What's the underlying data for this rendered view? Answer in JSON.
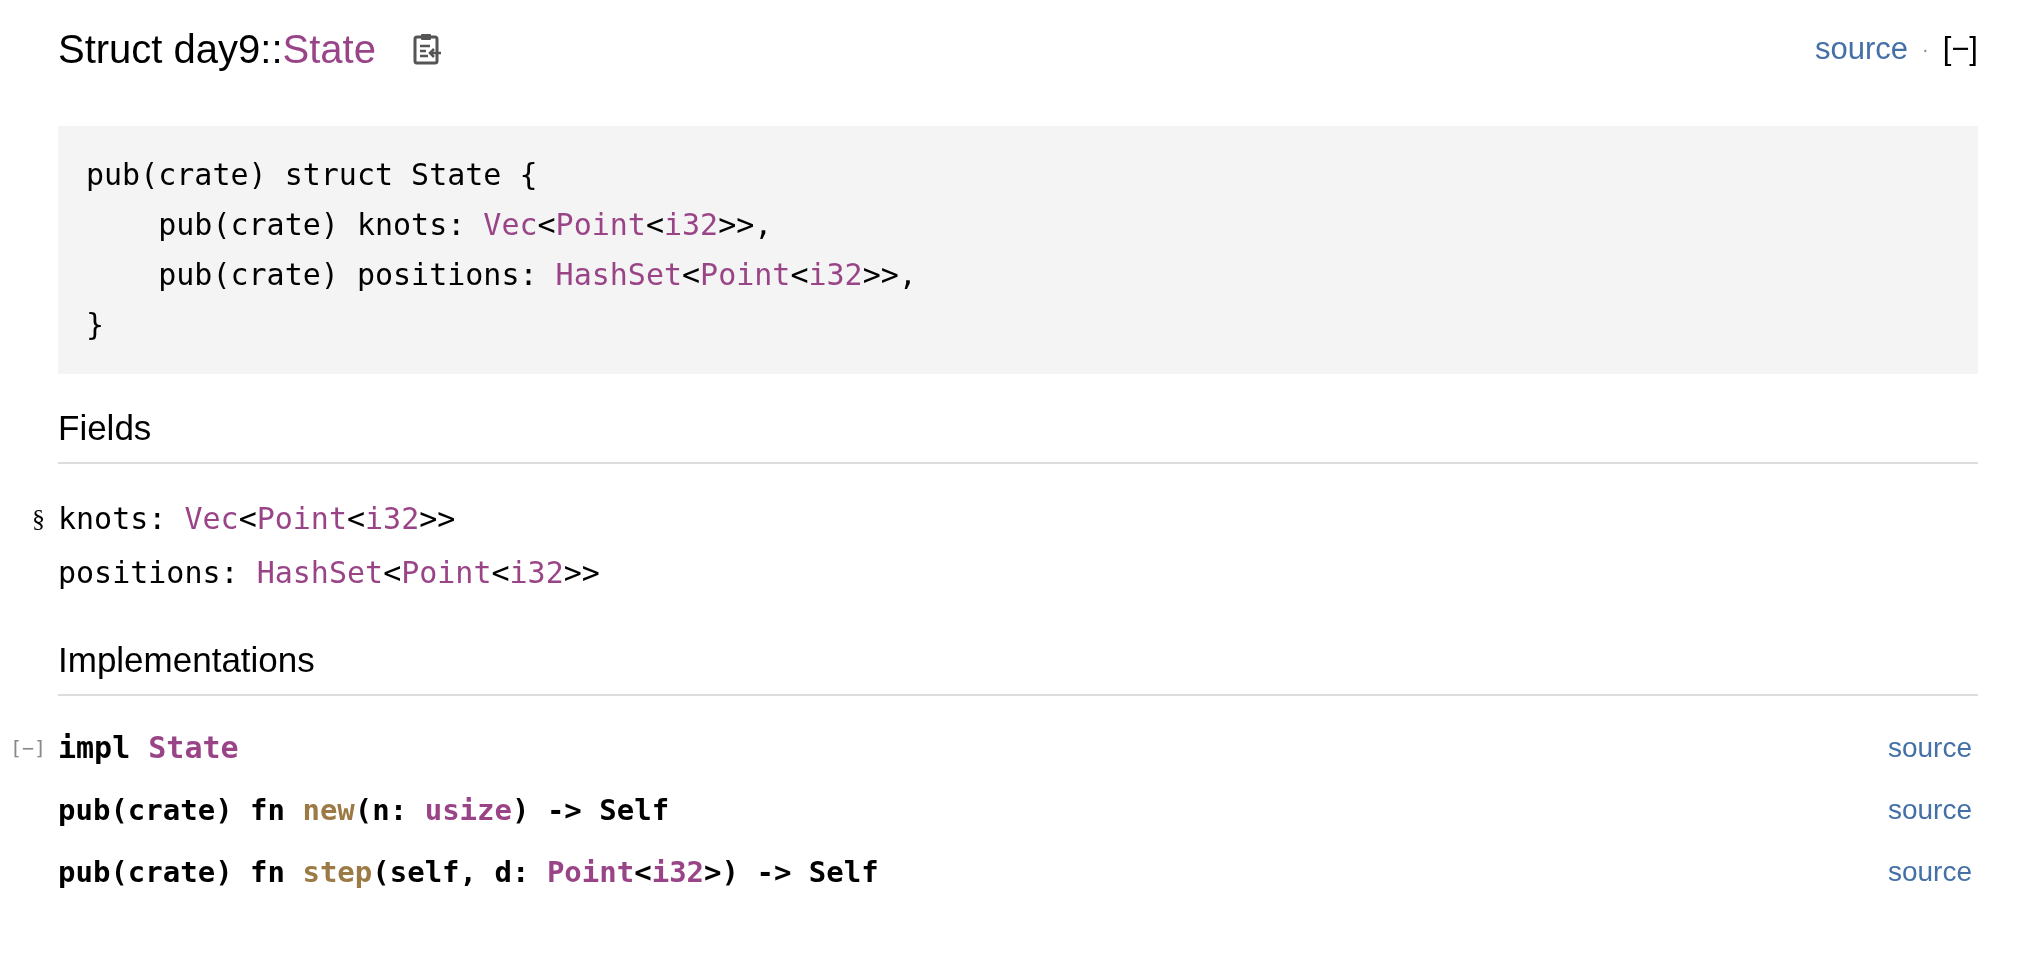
{
  "header": {
    "title": [
      {
        "text": "Struct day9::",
        "kind": "plain"
      },
      {
        "text": "State",
        "kind": "type"
      }
    ],
    "source_link": "source",
    "separator": "·",
    "collapse_toggle": "[−]"
  },
  "declaration": [
    [
      {
        "text": "pub(crate) struct State {",
        "kind": "plain"
      }
    ],
    [
      {
        "text": "    pub(crate) knots: ",
        "kind": "plain"
      },
      {
        "text": "Vec",
        "kind": "type"
      },
      {
        "text": "<",
        "kind": "plain"
      },
      {
        "text": "Point",
        "kind": "type"
      },
      {
        "text": "<",
        "kind": "plain"
      },
      {
        "text": "i32",
        "kind": "type"
      },
      {
        "text": ">>,",
        "kind": "plain"
      }
    ],
    [
      {
        "text": "    pub(crate) positions: ",
        "kind": "plain"
      },
      {
        "text": "HashSet",
        "kind": "type"
      },
      {
        "text": "<",
        "kind": "plain"
      },
      {
        "text": "Point",
        "kind": "type"
      },
      {
        "text": "<",
        "kind": "plain"
      },
      {
        "text": "i32",
        "kind": "type"
      },
      {
        "text": ">>,",
        "kind": "plain"
      }
    ],
    [
      {
        "text": "}",
        "kind": "plain"
      }
    ]
  ],
  "fields_heading": "Fields",
  "fields": [
    {
      "anchor": "§",
      "tokens": [
        {
          "text": "knots: ",
          "kind": "plain"
        },
        {
          "text": "Vec",
          "kind": "type"
        },
        {
          "text": "<",
          "kind": "plain"
        },
        {
          "text": "Point",
          "kind": "type"
        },
        {
          "text": "<",
          "kind": "plain"
        },
        {
          "text": "i32",
          "kind": "type"
        },
        {
          "text": ">>",
          "kind": "plain"
        }
      ]
    },
    {
      "tokens": [
        {
          "text": "positions: ",
          "kind": "plain"
        },
        {
          "text": "HashSet",
          "kind": "type"
        },
        {
          "text": "<",
          "kind": "plain"
        },
        {
          "text": "Point",
          "kind": "type"
        },
        {
          "text": "<",
          "kind": "plain"
        },
        {
          "text": "i32",
          "kind": "type"
        },
        {
          "text": ">>",
          "kind": "plain"
        }
      ]
    }
  ],
  "implementations_heading": "Implementations",
  "impl": {
    "expanded": true,
    "toggle": "[−]",
    "tokens": [
      {
        "text": "impl ",
        "kind": "plain"
      },
      {
        "text": "State",
        "kind": "type"
      }
    ],
    "source_link": "source",
    "methods": [
      {
        "tokens": [
          {
            "text": "pub(crate) fn ",
            "kind": "plain"
          },
          {
            "text": "new",
            "kind": "fn"
          },
          {
            "text": "(n: ",
            "kind": "plain"
          },
          {
            "text": "usize",
            "kind": "type"
          },
          {
            "text": ") -> Self",
            "kind": "plain"
          }
        ],
        "source_link": "source"
      },
      {
        "tokens": [
          {
            "text": "pub(crate) fn ",
            "kind": "plain"
          },
          {
            "text": "step",
            "kind": "fn"
          },
          {
            "text": "(self, d: ",
            "kind": "plain"
          },
          {
            "text": "Point",
            "kind": "type"
          },
          {
            "text": "<",
            "kind": "plain"
          },
          {
            "text": "i32",
            "kind": "type"
          },
          {
            "text": ">) -> Self",
            "kind": "plain"
          }
        ],
        "source_link": "source"
      }
    ]
  }
}
